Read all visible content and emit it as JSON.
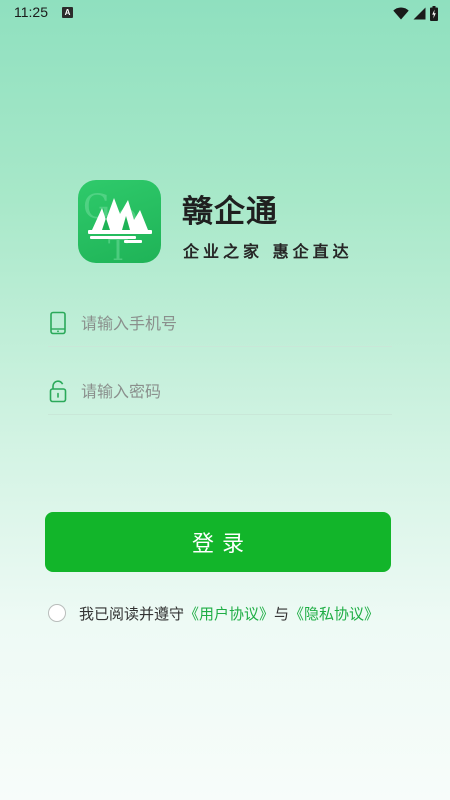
{
  "status_bar": {
    "time": "11:25",
    "notification_icon": "a-letter-icon",
    "icons": [
      "wifi-icon",
      "cellular-signal-icon",
      "battery-charging-icon"
    ]
  },
  "brand": {
    "logo_icon": "gov-building-logo",
    "title": "赣企通",
    "slogan": "企业之家 惠企直达"
  },
  "form": {
    "phone": {
      "icon": "phone-icon",
      "placeholder": "请输入手机号",
      "value": ""
    },
    "password": {
      "icon": "lock-icon",
      "placeholder": "请输入密码",
      "value": ""
    },
    "login_label": "登录"
  },
  "agreement": {
    "checked": false,
    "prefix": "我已阅读并遵守",
    "user_agreement": "《用户协议》",
    "conjunction": "与",
    "privacy_policy": "《隐私协议》"
  },
  "colors": {
    "accent": "#12b52a",
    "link": "#1fae45",
    "logo": "#22b85c"
  }
}
